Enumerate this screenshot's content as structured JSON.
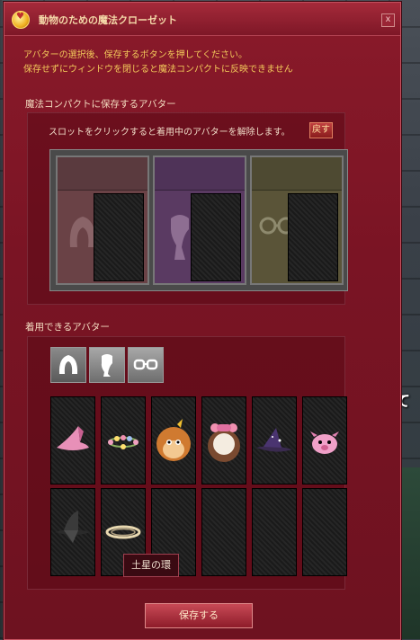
{
  "window": {
    "title": "動物のための魔法クローゼット",
    "close_label": "x"
  },
  "intro": {
    "line1": "アバターの選択後、保存するボタンを押してください。",
    "line2": "保存せずにウィンドウを閉じると魔法コンパクトに反映できません"
  },
  "saved_section": {
    "label": "魔法コンパクトに保存するアバター",
    "instruction": "スロットをクリックすると着用中のアバターを解除します。",
    "revert_label": "戻す",
    "slots": [
      {
        "type": "hat-icon",
        "color": "#6a4246",
        "top": "#5a3a3e"
      },
      {
        "type": "scarf-icon",
        "color": "#5a3a62",
        "top": "#4f3358"
      },
      {
        "type": "glasses-icon",
        "color": "#5a5438",
        "top": "#4e4a32"
      }
    ]
  },
  "wearable_section": {
    "label": "着用できるアバター",
    "tabs": [
      "hat-icon",
      "scarf-icon",
      "glasses-icon"
    ],
    "items": [
      "pink-witch-hat-icon",
      "flower-crown-icon",
      "monkey-head-icon",
      "sheep-head-icon",
      "purple-witch-hat-icon",
      "pink-pig-hat-icon",
      "black-witch-hat-icon",
      "saturn-ring-icon",
      "",
      "",
      "",
      ""
    ],
    "tooltip": "土星の環"
  },
  "save_button_label": "保存する",
  "side_text": "おて"
}
